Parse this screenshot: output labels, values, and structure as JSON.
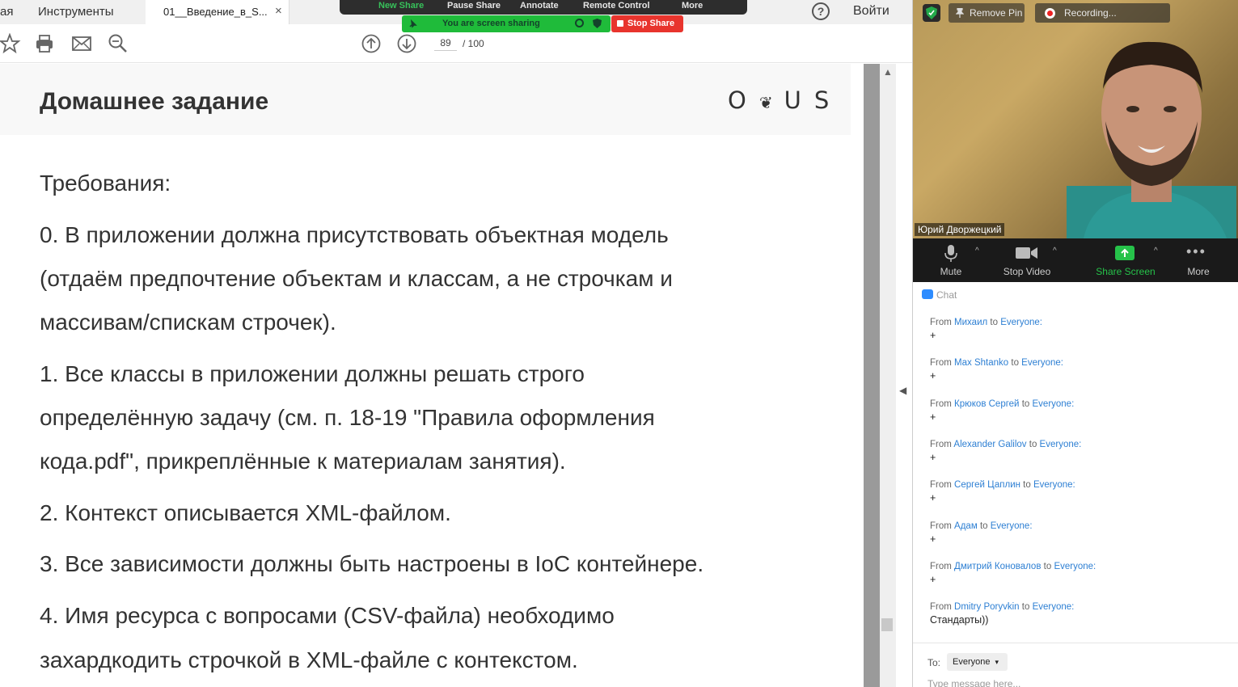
{
  "browser": {
    "tab_partial_left": "ая",
    "tab_tools": "Инструменты",
    "tab_active": "01__Введение_в_S...",
    "tab_close": "×",
    "help": "?",
    "login": "Войти"
  },
  "pdf_toolbar": {
    "page_current": "89",
    "page_total": "/  100"
  },
  "zoom_share": {
    "items": [
      "New Share",
      "Pause Share",
      "Annotate",
      "Remote Control",
      "More"
    ],
    "sharing_text": "You are screen sharing",
    "stop_label": "Stop Share"
  },
  "document": {
    "title": "Домашнее задание",
    "logo": "OTUS",
    "lines": [
      "Требования:",
      "0. В приложении должна присутствовать объектная модель",
      "(отдаём предпочтение объектам и классам, а не строчкам и",
      "массивам/спискам строчек).",
      "1. Все классы в приложении должны решать строго",
      "определённую задачу (см. п. 18-19 \"Правила оформления",
      "кода.pdf\", прикреплённые к материалам занятия).",
      "2. Контекст описывается XML-файлом.",
      "3. Все зависимости должны быть настроены в IoC контейнере.",
      "4. Имя ресурса с вопросами (CSV-файла) необходимо",
      "захардкодить строчкой в XML-файле с контекстом."
    ]
  },
  "zoom": {
    "remove_pin": "Remove Pin",
    "recording": "Recording...",
    "participant_name": "Юрий Дворжецкий",
    "controls": {
      "mute": "Mute",
      "stop_video": "Stop Video",
      "share_screen": "Share Screen",
      "more": "More"
    },
    "chat": {
      "title": "Chat",
      "from_word": "From",
      "to_word": "to",
      "everyone": "Everyone:",
      "messages": [
        {
          "sender": "Михаил",
          "text": "+"
        },
        {
          "sender": "Max Shtanko",
          "text": "+"
        },
        {
          "sender": "Крюков Сергей",
          "text": "+"
        },
        {
          "sender": "Alexander Galilov",
          "text": "+"
        },
        {
          "sender": "Сергей Цаплин",
          "text": "+"
        },
        {
          "sender": "Адам",
          "text": "+"
        },
        {
          "sender": "Дмитрий Коновалов",
          "text": "+"
        },
        {
          "sender": "Dmitry Poryvkin",
          "text": "Стандарты))"
        }
      ],
      "to_label": "To:",
      "to_value": "Everyone",
      "input_placeholder": "Type message here..."
    }
  },
  "colors": {
    "zoom_green": "#1fbb3a",
    "stop_red": "#e8342d",
    "chat_name_blue": "#2d7fd3"
  }
}
